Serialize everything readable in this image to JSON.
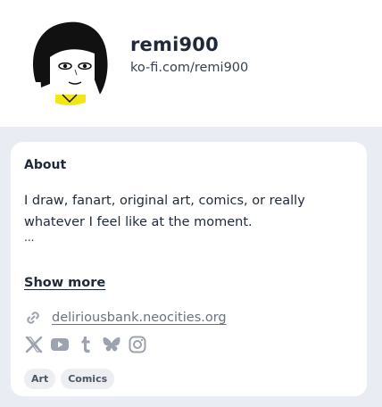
{
  "profile": {
    "name": "remi900",
    "url": "ko-fi.com/remi900"
  },
  "about": {
    "title": "About",
    "text": "I draw, fanart, original art, comics, or really whatever I feel like at the moment.",
    "ellipsis": "...",
    "show_more": "Show more"
  },
  "website": {
    "icon": "link-icon",
    "label": "deliriousbank.neocities.org"
  },
  "socials": [
    "x-icon",
    "youtube-icon",
    "tumblr-icon",
    "bluesky-icon",
    "instagram-icon"
  ],
  "tags": [
    "Art",
    "Comics"
  ],
  "colors": {
    "panel_bg": "#e9ecf3",
    "card_bg": "#ffffff",
    "muted": "#9ca3af",
    "text": "#1f2937"
  }
}
